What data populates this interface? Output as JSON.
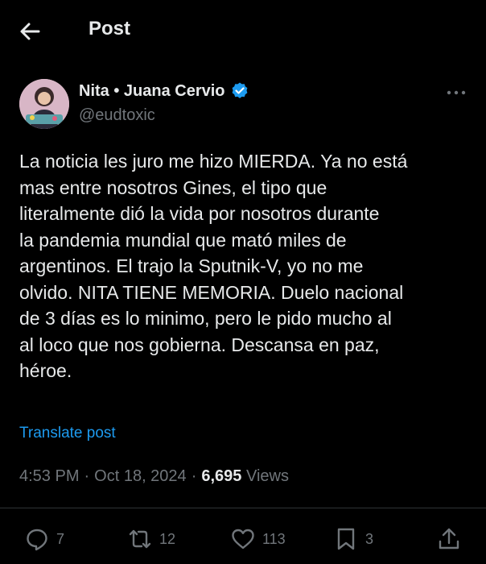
{
  "header": {
    "title": "Post"
  },
  "author": {
    "display_name": "Nita • Juana Cervio",
    "handle": "@eudtoxic"
  },
  "post": {
    "text": "La noticia les juro me hizo MIERDA. Ya no está\nmas entre nosotros Gines, el tipo que\nliteralmente dió la vida por nosotros durante\nla pandemia mundial que mató miles de\nargentinos. El trajo la Sputnik-V, yo no me\nolvido. NITA TIENE MEMORIA. Duelo nacional\nde 3 días es lo minimo, pero le pido mucho al\nal loco que nos gobierna. Descansa en paz,\nhéroe.",
    "translate_label": "Translate post"
  },
  "meta": {
    "time": "4:53 PM",
    "separator": "·",
    "date": "Oct 18, 2024",
    "views_count": "6,695",
    "views_label": "Views"
  },
  "actions": {
    "replies": "7",
    "reposts": "12",
    "likes": "113",
    "bookmarks": "3"
  },
  "colors": {
    "background": "#000000",
    "text": "#e7e9ea",
    "secondary": "#71767b",
    "accent": "#1d9bf0"
  }
}
